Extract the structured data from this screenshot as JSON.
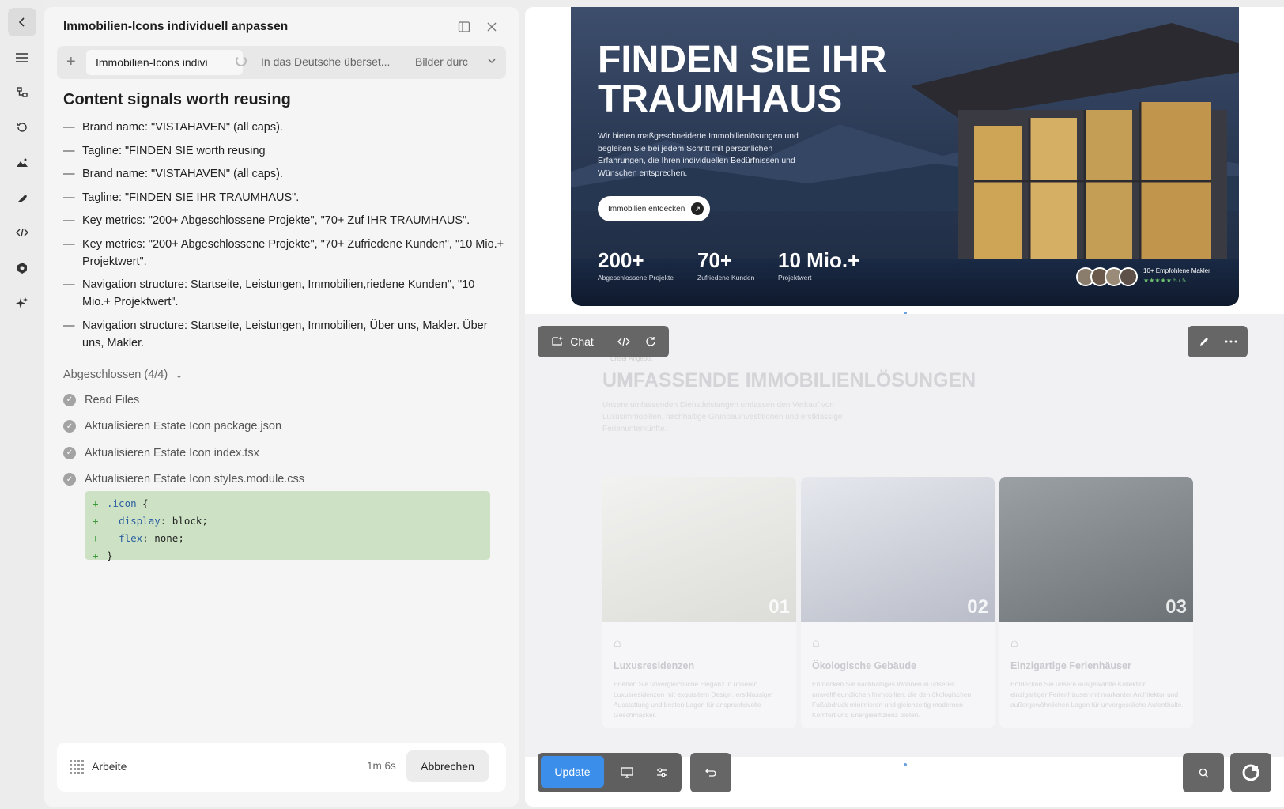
{
  "rail": {
    "icons": [
      "back-icon",
      "menu-icon",
      "tree-icon",
      "history-icon",
      "image-icon",
      "brush-icon",
      "code-icon",
      "settings-icon",
      "sparkle-icon"
    ]
  },
  "panel": {
    "title": "Immobilien-Icons individuell anpassen",
    "tabs": [
      "Immobilien-Icons indivi",
      "In das Deutsche überset...",
      "Bilder durc"
    ],
    "heading": "Content signals worth reusing",
    "bullets": [
      "Brand name: \"VISTAHAVEN\" (all caps).",
      "Tagline: \"FINDEN SIE worth reusing",
      "Brand name: \"VISTAHAVEN\" (all caps).",
      "Tagline: \"FINDEN SIE IHR TRAUMHAUS\".",
      "Key metrics: \"200+ Abgeschlossene Projekte\", \"70+ Zuf IHR TRAUMHAUS\".",
      "Key metrics: \"200+ Abgeschlossene Projekte\", \"70+ Zufriedene Kunden\", \"10 Mio.+ Projektwert\".",
      "Navigation structure: Startseite, Leistungen, Immobilien,riedene Kunden\", \"10 Mio.+ Projektwert\".",
      "Navigation structure: Startseite, Leistungen, Immobilien, Über uns, Makler. Über uns, Makler."
    ],
    "done_header": "Abgeschlossen (4/4)",
    "steps": [
      "Read Files",
      "Aktualisieren Estate Icon package.json",
      "Aktualisieren Estate Icon index.tsx",
      "Aktualisieren Estate Icon styles.module.css"
    ],
    "code": {
      "line1_sel": ".icon",
      "line1_brace": " {",
      "line2_prop": "display",
      "line2_val": ": block;",
      "line3_prop": "flex",
      "line3_val": ": none;",
      "line4": "}"
    },
    "footer": {
      "status": "Arbeite",
      "time": "1m 6s",
      "cancel": "Abbrechen"
    }
  },
  "preview": {
    "hero": {
      "title": "FINDEN SIE IHR TRAUMHAUS",
      "desc": "Wir bieten maßgeschneiderte Immobilienlösungen und begleiten Sie bei jedem Schritt mit persönlichen Erfahrungen, die Ihren individuellen Bedürfnissen und Wünschen entsprechen.",
      "cta": "Immobilien entdecken",
      "stats": [
        {
          "value": "200+",
          "label": "Abgeschlossene Projekte"
        },
        {
          "value": "70+",
          "label": "Zufriedene Kunden"
        },
        {
          "value": "10 Mio.+",
          "label": "Projektwert"
        }
      ],
      "reviews_label": "10+ Empfohlene Makler",
      "stars": "★★★★★ 5 / 5"
    },
    "section": {
      "tag": "Unser Angebot",
      "title": "UMFASSENDE IMMOBILIENLÖSUNGEN",
      "desc": "Unsere umfassenden Dienstleistungen umfassen den Verkauf von Luxusimmobilien, nachhaltige Grünbauinvestitionen und erstklassige Ferienunterkünfte.",
      "cards": [
        {
          "num": "01",
          "title": "Luxusresidenzen",
          "desc": "Erleben Sie unvergleichliche Eleganz in unseren Luxusresidenzen mit exquisitem Design, erstklassiger Ausstattung und besten Lagen für anspruchsvolle Geschmäcker."
        },
        {
          "num": "02",
          "title": "Ökologische Gebäude",
          "desc": "Entdecken Sie nachhaltiges Wohnen in unseren umweltfreundlichen Immobilien, die den ökologischen Fußabdruck minimieren und gleichzeitig modernen Komfort und Energieeffizienz bieten."
        },
        {
          "num": "03",
          "title": "Einzigartige Ferienhäuser",
          "desc": "Entdecken Sie unsere ausgewählte Kollektion einzigartiger Ferienhäuser mit markanter Architektur und außergewöhnlichen Lagen für unvergessliche Aufenthalte."
        }
      ]
    },
    "toolbar_top": {
      "chat": "Chat"
    },
    "toolbar_bottom": {
      "update": "Update"
    }
  }
}
